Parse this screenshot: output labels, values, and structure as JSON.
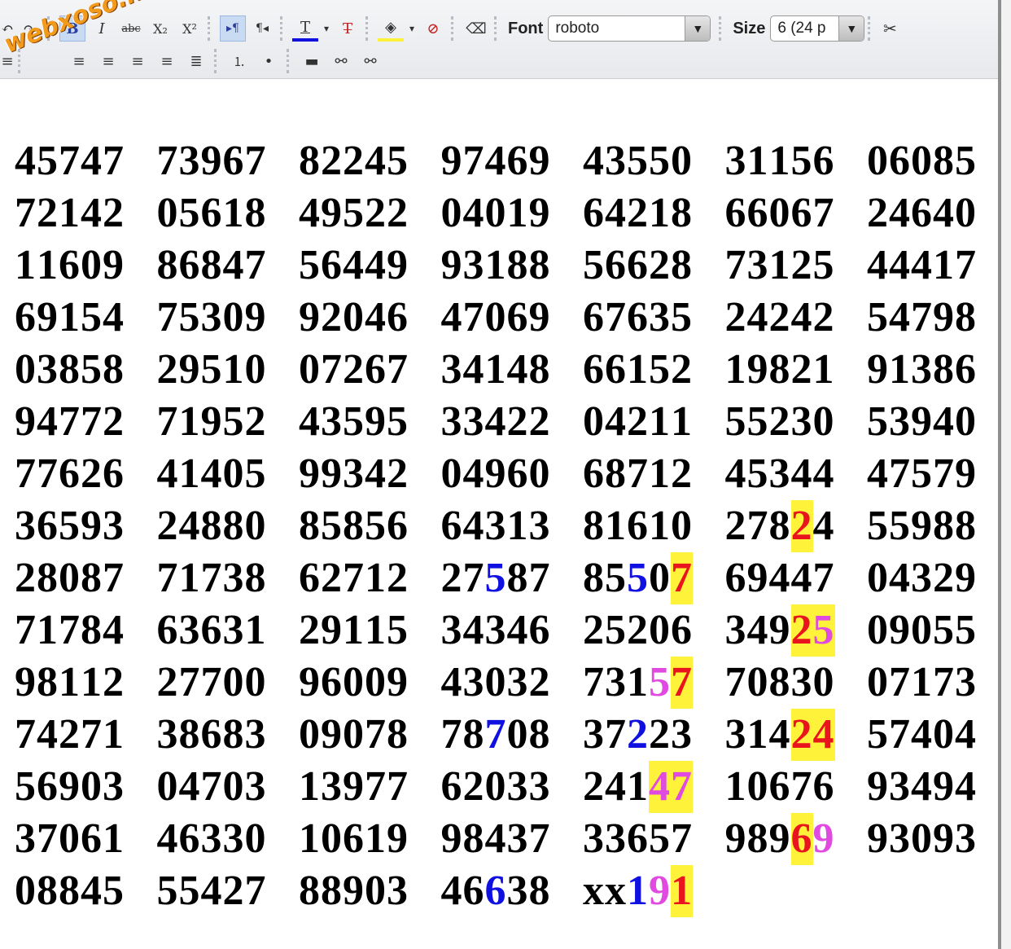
{
  "toolbar": {
    "watermark": "webxoso.net",
    "font_label": "Font",
    "font_value": "roboto",
    "size_label": "Size",
    "size_value": "6 (24 p",
    "row1_glyphs": [
      "↶",
      "↷",
      "B",
      "I",
      "abc",
      "X₂",
      "X²",
      "▸¶",
      "¶◂",
      "T",
      "▾",
      "T̶",
      "◈",
      "▾",
      "⊘",
      "⌫"
    ],
    "row2_glyphs": [
      "≡",
      "≡",
      "≡",
      "≡",
      "≣",
      "⒈",
      "•",
      "▬",
      "⚯",
      "⚯"
    ]
  },
  "colors": {
    "highlight": "#fff23a",
    "blue": "#1010e0",
    "pink": "#e04ae0",
    "red": "#e8141e"
  },
  "numbers": [
    [
      "45747",
      "73967",
      "82245",
      "97469",
      "43550",
      "31156",
      "06085"
    ],
    [
      "72142",
      "05618",
      "49522",
      "04019",
      "64218",
      "66067",
      "24640"
    ],
    [
      "11609",
      "86847",
      "56449",
      "93188",
      "56628",
      "73125",
      "44417"
    ],
    [
      "69154",
      "75309",
      "92046",
      "47069",
      "67635",
      "24242",
      "54798"
    ],
    [
      "03858",
      "29510",
      "07267",
      "34148",
      "66152",
      "19821",
      "91386"
    ],
    [
      "94772",
      "71952",
      "43595",
      "33422",
      "04211",
      "55230",
      "53940"
    ],
    [
      "77626",
      "41405",
      "99342",
      "04960",
      "68712",
      "45344",
      "47579"
    ],
    [
      "36593",
      "24880",
      "85856",
      "64313",
      "81610",
      "27824",
      "55988"
    ],
    [
      "28087",
      "71738",
      "62712",
      "27587",
      "85507",
      "69447",
      "04329"
    ],
    [
      "71784",
      "63631",
      "29115",
      "34346",
      "25206",
      "34925",
      "09055"
    ],
    [
      "98112",
      "27700",
      "96009",
      "43032",
      "73157",
      "70830",
      "07173"
    ],
    [
      "74271",
      "38683",
      "09078",
      "78708",
      "37223",
      "31424",
      "57404"
    ],
    [
      "56903",
      "04703",
      "13977",
      "62033",
      "24147",
      "10676",
      "93494"
    ],
    [
      "37061",
      "46330",
      "10619",
      "98437",
      "33657",
      "98969",
      "93093"
    ],
    [
      "08845",
      "55427",
      "88903",
      "46638",
      "xx191"
    ]
  ],
  "styled_digits": [
    {
      "row": 7,
      "col": 5,
      "digit": 3,
      "color": "red",
      "highlight": true
    },
    {
      "row": 8,
      "col": 3,
      "digit": 2,
      "color": "blue",
      "highlight": false
    },
    {
      "row": 8,
      "col": 4,
      "digit": 2,
      "color": "blue",
      "highlight": false
    },
    {
      "row": 8,
      "col": 4,
      "digit": 4,
      "color": "red",
      "highlight": true
    },
    {
      "row": 9,
      "col": 5,
      "digit": 3,
      "color": "red",
      "highlight": true
    },
    {
      "row": 9,
      "col": 5,
      "digit": 4,
      "color": "pink",
      "highlight": true
    },
    {
      "row": 10,
      "col": 4,
      "digit": 3,
      "color": "pink",
      "highlight": false
    },
    {
      "row": 10,
      "col": 4,
      "digit": 4,
      "color": "red",
      "highlight": true
    },
    {
      "row": 11,
      "col": 3,
      "digit": 2,
      "color": "blue",
      "highlight": false
    },
    {
      "row": 11,
      "col": 4,
      "digit": 2,
      "color": "blue",
      "highlight": false
    },
    {
      "row": 11,
      "col": 5,
      "digit": 3,
      "color": "red",
      "highlight": true
    },
    {
      "row": 11,
      "col": 5,
      "digit": 4,
      "color": "red",
      "highlight": true
    },
    {
      "row": 12,
      "col": 4,
      "digit": 3,
      "color": "pink",
      "highlight": true
    },
    {
      "row": 12,
      "col": 4,
      "digit": 4,
      "color": "pink",
      "highlight": true
    },
    {
      "row": 13,
      "col": 5,
      "digit": 3,
      "color": "red",
      "highlight": true
    },
    {
      "row": 13,
      "col": 5,
      "digit": 4,
      "color": "pink",
      "highlight": false
    },
    {
      "row": 14,
      "col": 3,
      "digit": 2,
      "color": "blue",
      "highlight": false
    },
    {
      "row": 14,
      "col": 4,
      "digit": 2,
      "color": "blue",
      "highlight": false
    },
    {
      "row": 14,
      "col": 4,
      "digit": 3,
      "color": "pink",
      "highlight": false
    },
    {
      "row": 14,
      "col": 4,
      "digit": 4,
      "color": "red",
      "highlight": true
    }
  ]
}
